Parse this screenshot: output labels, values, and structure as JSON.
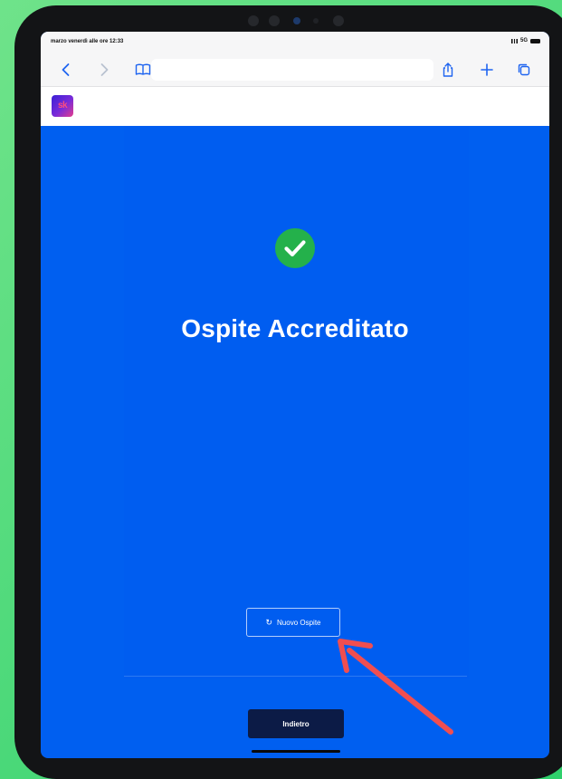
{
  "status_bar": {
    "time_text": "marzo venerdì alle ore 12:33",
    "network_text": "5G"
  },
  "browser": {
    "address_value": "",
    "icons": [
      "back-chevron-icon",
      "forward-chevron-icon",
      "bookmarks-book-icon",
      "share-icon",
      "new-tab-plus-icon",
      "tabs-overview-icon"
    ]
  },
  "site": {
    "logo_text": "sk"
  },
  "main": {
    "success_icon": "check-circle-icon",
    "title": "Ospite Accreditato",
    "new_guest_button_label": "Nuovo Ospite",
    "back_button_label": "Indietro"
  },
  "colors": {
    "background_green": "#3fd672",
    "screen_blue": "#005ff0",
    "success_green": "#24b14b",
    "back_button": "#0c1b46",
    "annotation_arrow": "#f04e50"
  }
}
